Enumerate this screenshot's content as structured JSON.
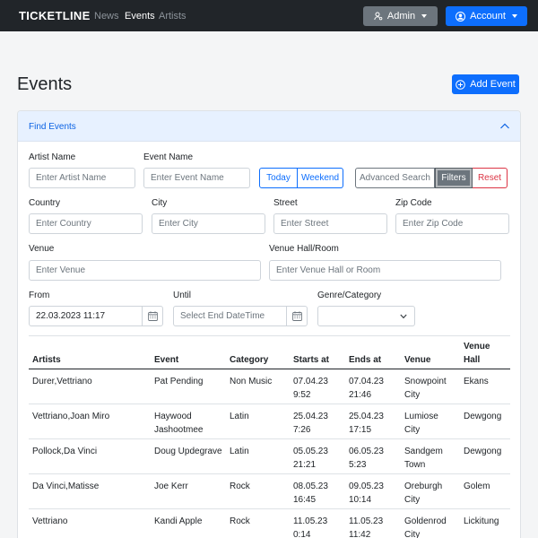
{
  "navbar": {
    "brand": "TICKETLINE",
    "links": [
      "News",
      "Events",
      "Artists"
    ],
    "admin_label": "Admin",
    "account_label": "Account"
  },
  "page": {
    "title": "Events",
    "add_label": "Add Event"
  },
  "filter": {
    "header": "Find Events",
    "artist_label": "Artist Name",
    "artist_placeholder": "Enter Artist Name",
    "event_label": "Event Name",
    "event_placeholder": "Enter Event Name",
    "today_label": "Today",
    "weekend_label": "Weekend",
    "advanced_label": "Advanced Search",
    "filters_label": "Filters",
    "reset_label": "Reset",
    "country_label": "Country",
    "country_placeholder": "Enter Country",
    "city_label": "City",
    "city_placeholder": "Enter City",
    "street_label": "Street",
    "street_placeholder": "Enter Street",
    "zip_label": "Zip Code",
    "zip_placeholder": "Enter Zip Code",
    "venue_label": "Venue",
    "venue_placeholder": "Enter Venue",
    "hall_label": "Venue Hall/Room",
    "hall_placeholder": "Enter Venue Hall or Room",
    "from_label": "From",
    "from_value": "22.03.2023 11:17",
    "until_label": "Until",
    "until_placeholder": "Select End DateTime",
    "genre_label": "Genre/Category",
    "genre_value": ""
  },
  "table": {
    "headers": {
      "artists": "Artists",
      "event": "Event",
      "category": "Category",
      "starts": "Starts at",
      "ends": "Ends at",
      "venue": "Venue",
      "hall_1": "Venue",
      "hall_2": "Hall"
    },
    "rows": [
      {
        "artists": "Durer,Vettriano",
        "event_1": "Pat Pending",
        "event_2": "",
        "category": "Non Music",
        "start_date": "07.04.23",
        "start_time": "9:52",
        "end_date": "07.04.23",
        "end_time": "21:46",
        "venue_1": "Snowpoint",
        "venue_2": "City",
        "hall": "Ekans"
      },
      {
        "artists": "Vettriano,Joan Miro",
        "event_1": "Haywood",
        "event_2": "Jashootmee",
        "category": "Latin",
        "start_date": "25.04.23",
        "start_time": "7:26",
        "end_date": "25.04.23",
        "end_time": "17:15",
        "venue_1": "Lumiose",
        "venue_2": "City",
        "hall": "Dewgong"
      },
      {
        "artists": "Pollock,Da Vinci",
        "event_1": "Doug Updegrave",
        "event_2": "",
        "category": "Latin",
        "start_date": "05.05.23",
        "start_time": "21:21",
        "end_date": "06.05.23",
        "end_time": "5:23",
        "venue_1": "Sandgem",
        "venue_2": "Town",
        "hall": "Dewgong"
      },
      {
        "artists": "Da Vinci,Matisse",
        "event_1": "Joe Kerr",
        "event_2": "",
        "category": "Rock",
        "start_date": "08.05.23",
        "start_time": "16:45",
        "end_date": "09.05.23",
        "end_time": "10:14",
        "venue_1": "Oreburgh",
        "venue_2": "City",
        "hall": "Golem"
      },
      {
        "artists": "Vettriano",
        "event_1": "Kandi Apple",
        "event_2": "",
        "category": "Rock",
        "start_date": "11.05.23",
        "start_time": "0:14",
        "end_date": "11.05.23",
        "end_time": "11:42",
        "venue_1": "Goldenrod",
        "venue_2": "City",
        "hall": "Lickitung"
      }
    ]
  },
  "colors": {
    "navbar": "#212529",
    "primary": "#0d6efd",
    "secondary": "#6c757d",
    "danger": "#dc3545",
    "card_header": "#e7f1ff"
  }
}
